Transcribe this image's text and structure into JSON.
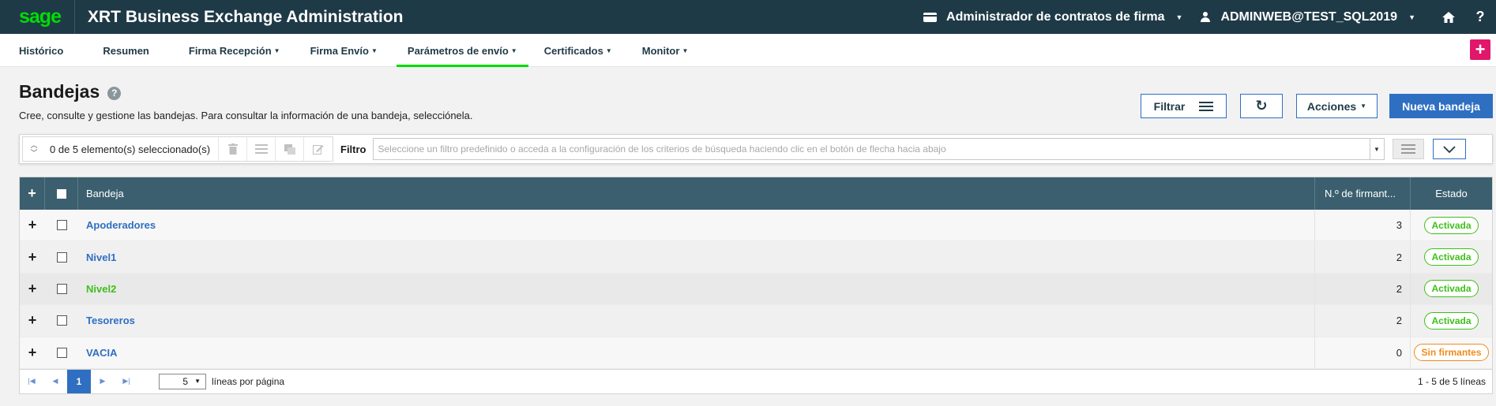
{
  "app": {
    "logo": "sage",
    "title": "XRT Business Exchange Administration",
    "contract_admin": "Administrador de contratos de firma",
    "user": "ADMINWEB@TEST_SQL2019"
  },
  "nav": {
    "items": [
      {
        "label": "Histórico",
        "has_menu": false
      },
      {
        "label": "Resumen",
        "has_menu": false
      },
      {
        "label": "Firma Recepción",
        "has_menu": true
      },
      {
        "label": "Firma Envío",
        "has_menu": true
      },
      {
        "label": "Parámetros de envío",
        "has_menu": true,
        "active": true
      },
      {
        "label": "Certificados",
        "has_menu": true
      },
      {
        "label": "Monitor",
        "has_menu": true
      }
    ],
    "add_label": "+"
  },
  "page": {
    "title": "Bandejas",
    "help": "?",
    "description": "Cree, consulte y gestione las bandejas. Para consultar la información de una bandeja, selecciónela."
  },
  "header_buttons": {
    "filter": "Filtrar",
    "refresh": "↻",
    "actions": "Acciones",
    "new": "Nueva bandeja"
  },
  "toolbar": {
    "selection": "0 de 5 elemento(s) seleccionado(s)",
    "filter_label": "Filtro",
    "filter_placeholder": "Seleccione un filtro predefinido o acceda a la configuración de los criterios de búsqueda haciendo clic en el botón de flecha hacia abajo"
  },
  "table": {
    "columns": {
      "expand": "+",
      "name": "Bandeja",
      "signers": "N.º de firmant...",
      "state": "Estado"
    },
    "rows": [
      {
        "name": "Apoderadores",
        "signers": "3",
        "state": "Activada",
        "state_color": "#3fbf1a",
        "highlight": false
      },
      {
        "name": "Nivel1",
        "signers": "2",
        "state": "Activada",
        "state_color": "#3fbf1a",
        "highlight": false
      },
      {
        "name": "Nivel2",
        "signers": "2",
        "state": "Activada",
        "state_color": "#3fbf1a",
        "highlight": true
      },
      {
        "name": "Tesoreros",
        "signers": "2",
        "state": "Activada",
        "state_color": "#3fbf1a",
        "highlight": false
      },
      {
        "name": "VACIA",
        "signers": "0",
        "state": "Sin firmantes",
        "state_color": "#f08a1c",
        "highlight": false
      }
    ]
  },
  "pager": {
    "current_page": "1",
    "page_size": "5",
    "page_size_label": "líneas por página",
    "count": "1 - 5 de 5 líneas"
  },
  "colors": {
    "topbar": "#1f3a47",
    "brand_green": "#00dc06",
    "primary": "#2f6fc2",
    "table_header": "#3b5f6e",
    "accent_pink": "#e0176a"
  }
}
